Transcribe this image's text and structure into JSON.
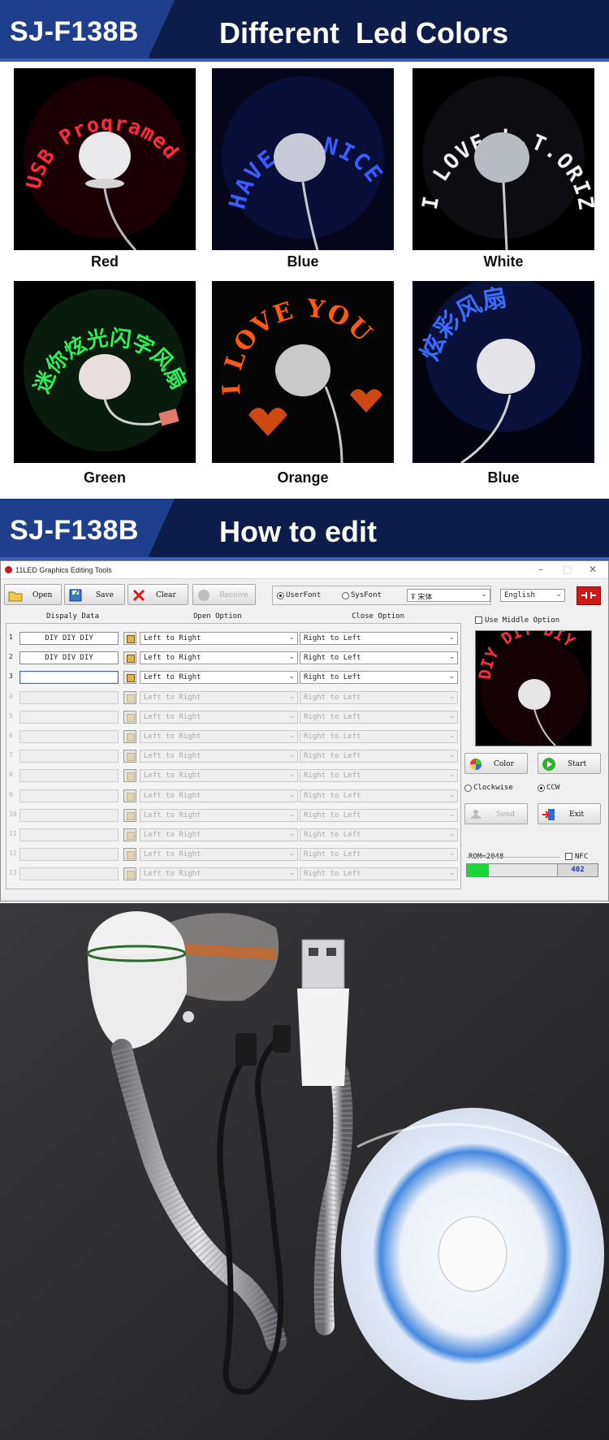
{
  "banner_colors": {
    "model": "SJ-F138B",
    "title": "Different  Led Colors"
  },
  "color_tiles": [
    {
      "label": "Red",
      "led_text": "USB Programed Fan",
      "led_color": "#ff2a3c"
    },
    {
      "label": "Blue",
      "led_text": "HAVE A NICE DAY",
      "led_color": "#3b5cff"
    },
    {
      "label": "White",
      "led_text": "I LOVE L.T.ORIZON",
      "led_color": "#f4f4f4"
    },
    {
      "label": "Green",
      "led_text": "迷你炫光闪字风扇",
      "led_color": "#2ff05a"
    },
    {
      "label": "Orange",
      "led_text": "I LOVE YOU",
      "led_color": "#ff5a14"
    },
    {
      "label": "Blue",
      "led_text": "炫彩风扇",
      "led_color": "#3a6dff"
    }
  ],
  "banner_edit": {
    "model": "SJ-F138B",
    "title": "How to edit"
  },
  "software": {
    "title": "11LED Graphics Editing Tools",
    "toolbar": {
      "open": "Open",
      "save": "Save",
      "clear": "Clear",
      "receive": "Receive",
      "userfont": "UserFont",
      "sysfont": "SysFont",
      "font_value": "宋体",
      "language": "English"
    },
    "headers": {
      "display": "Dispaly Data",
      "open": "Open Option",
      "close": "Close Option"
    },
    "rows": [
      {
        "num": "1",
        "data": "DIY DIY DIY",
        "open": "Left to Right",
        "close": "Right to Left",
        "enabled": true
      },
      {
        "num": "2",
        "data": "DIY DIV DIY",
        "open": "Left to Right",
        "close": "Right to Left",
        "enabled": true
      },
      {
        "num": "3",
        "data": "",
        "open": "Left to Right",
        "close": "Right to Left",
        "enabled": true
      },
      {
        "num": "4",
        "data": "",
        "open": "Left to Right",
        "close": "Right to Left",
        "enabled": false
      },
      {
        "num": "5",
        "data": "",
        "open": "Left to Right",
        "close": "Right to Left",
        "enabled": false
      },
      {
        "num": "6",
        "data": "",
        "open": "Left to Right",
        "close": "Right to Left",
        "enabled": false
      },
      {
        "num": "7",
        "data": "",
        "open": "Left to Right",
        "close": "Right to Left",
        "enabled": false
      },
      {
        "num": "8",
        "data": "",
        "open": "Left to Right",
        "close": "Right to Left",
        "enabled": false
      },
      {
        "num": "9",
        "data": "",
        "open": "Left to Right",
        "close": "Right to Left",
        "enabled": false
      },
      {
        "num": "10",
        "data": "",
        "open": "Left to Right",
        "close": "Right to Left",
        "enabled": false
      },
      {
        "num": "11",
        "data": "",
        "open": "Left to Right",
        "close": "Right to Left",
        "enabled": false
      },
      {
        "num": "12",
        "data": "",
        "open": "Left to Right",
        "close": "Right to Left",
        "enabled": false
      },
      {
        "num": "13",
        "data": "",
        "open": "Left to Right",
        "close": "Right to Left",
        "enabled": false
      }
    ],
    "middle_option": "Use Middle Option",
    "preview_text": "DIY DIY DIY",
    "buttons": {
      "color": "Color",
      "start": "Start",
      "send": "Send",
      "exit": "Exit"
    },
    "rotation": {
      "clockwise": "Clockwise",
      "ccw": "CCW",
      "selected": "ccw"
    },
    "rom": "ROM=2048",
    "nfc": "NFC",
    "progress": {
      "fraction": 0.17,
      "count": "402"
    }
  }
}
